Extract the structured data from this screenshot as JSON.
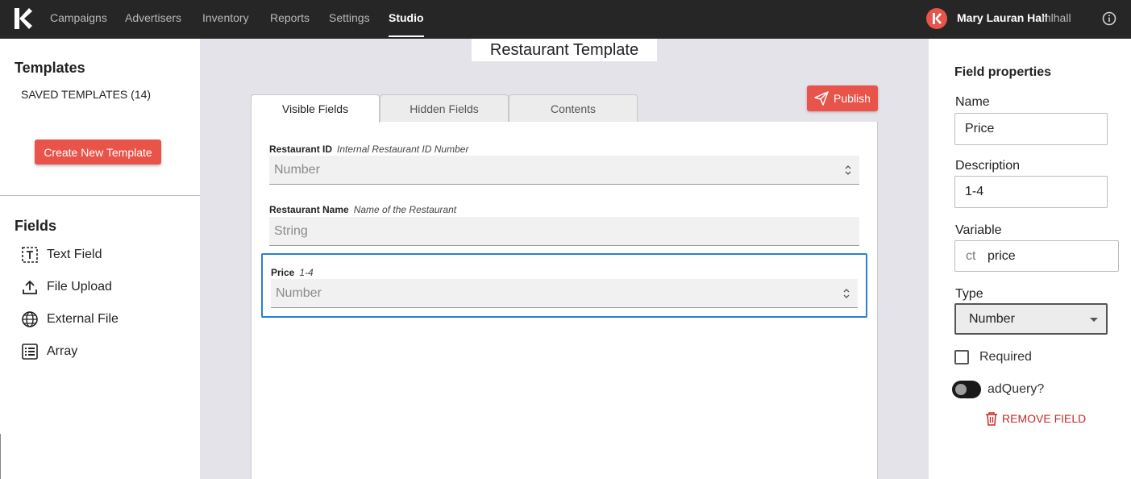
{
  "nav": {
    "items": [
      "Campaigns",
      "Advertisers",
      "Inventory",
      "Reports",
      "Settings",
      "Studio"
    ],
    "active": "Studio",
    "user_name": "Mary Lauran Hall",
    "user_handle": "mlhall"
  },
  "sidebar": {
    "templates_heading": "Templates",
    "saved_templates": "SAVED TEMPLATES (14)",
    "create_button": "Create New Template",
    "fields_heading": "Fields",
    "field_types": [
      {
        "label": "Text Field",
        "icon": "text-field-icon"
      },
      {
        "label": "File Upload",
        "icon": "upload-icon"
      },
      {
        "label": "External File",
        "icon": "globe-icon"
      },
      {
        "label": "Array",
        "icon": "list-icon"
      }
    ]
  },
  "editor": {
    "template_title": "Restaurant Template",
    "publish_button": "Publish",
    "tabs": [
      "Visible Fields",
      "Hidden Fields",
      "Contents"
    ],
    "active_tab": "Visible Fields",
    "fields": [
      {
        "label": "Restaurant ID",
        "description": "Internal Restaurant ID Number",
        "placeholder": "Number"
      },
      {
        "label": "Restaurant Name",
        "description": "Name of the Restaurant",
        "placeholder": "String"
      },
      {
        "label": "Price",
        "description": "1-4",
        "placeholder": "Number"
      }
    ]
  },
  "properties": {
    "title": "Field properties",
    "name_label": "Name",
    "name_value": "Price",
    "description_label": "Description",
    "description_value": "1-4",
    "variable_label": "Variable",
    "variable_prefix": "ct",
    "variable_value": "price",
    "type_label": "Type",
    "type_value": "Number",
    "required_label": "Required",
    "adquery_label": "adQuery?",
    "remove_label": "REMOVE FIELD"
  },
  "colors": {
    "accent": "#e8534a",
    "selection": "#2a7fd1",
    "danger": "#c62828",
    "topbar": "#262626"
  }
}
